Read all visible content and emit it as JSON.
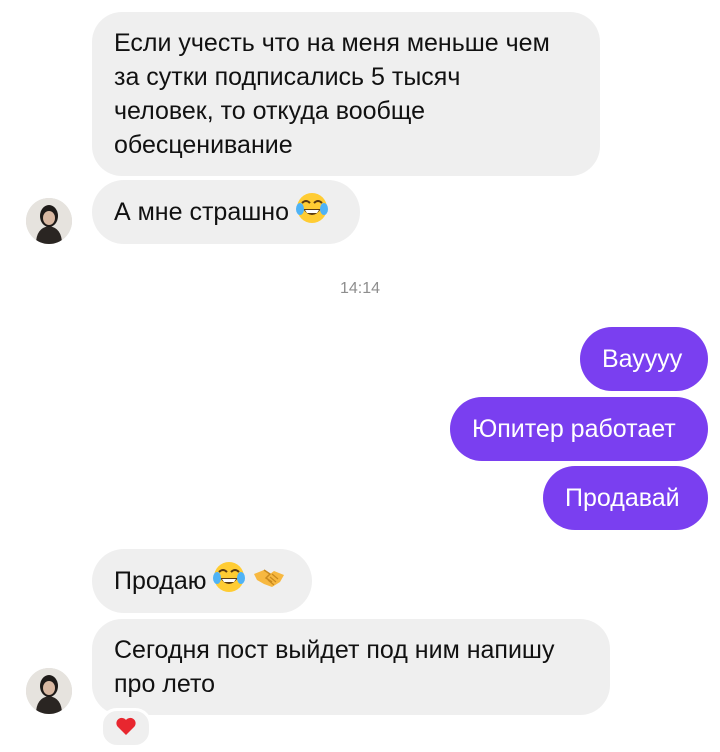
{
  "conversation": {
    "messages": [
      {
        "direction": "incoming",
        "lines": [
          "Если учесть что на меня меньше чем",
          "за сутки подписались 5 тысяч",
          "человек, то откуда вообще",
          "обесценивание"
        ]
      },
      {
        "direction": "incoming",
        "text": "А мне страшно",
        "emoji": [
          "face-with-tears-of-joy-emoji"
        ]
      },
      {
        "direction": "outgoing",
        "text": "Вауууу"
      },
      {
        "direction": "outgoing",
        "text": "Юпитер работает"
      },
      {
        "direction": "outgoing",
        "text": "Продавай"
      },
      {
        "direction": "incoming",
        "text": "Продаю",
        "emoji": [
          "face-with-tears-of-joy-emoji",
          "handshake-emoji"
        ]
      },
      {
        "direction": "incoming",
        "lines": [
          "Сегодня пост выйдет под ним напишу",
          "про лето"
        ],
        "reaction": "red-heart-emoji"
      }
    ],
    "timestamp": "14:14"
  },
  "colors": {
    "incoming_bubble": "#efefef",
    "outgoing_bubble": "#7a3ff0",
    "outgoing_text": "#ffffff",
    "timestamp_text": "#8e8e8e"
  }
}
